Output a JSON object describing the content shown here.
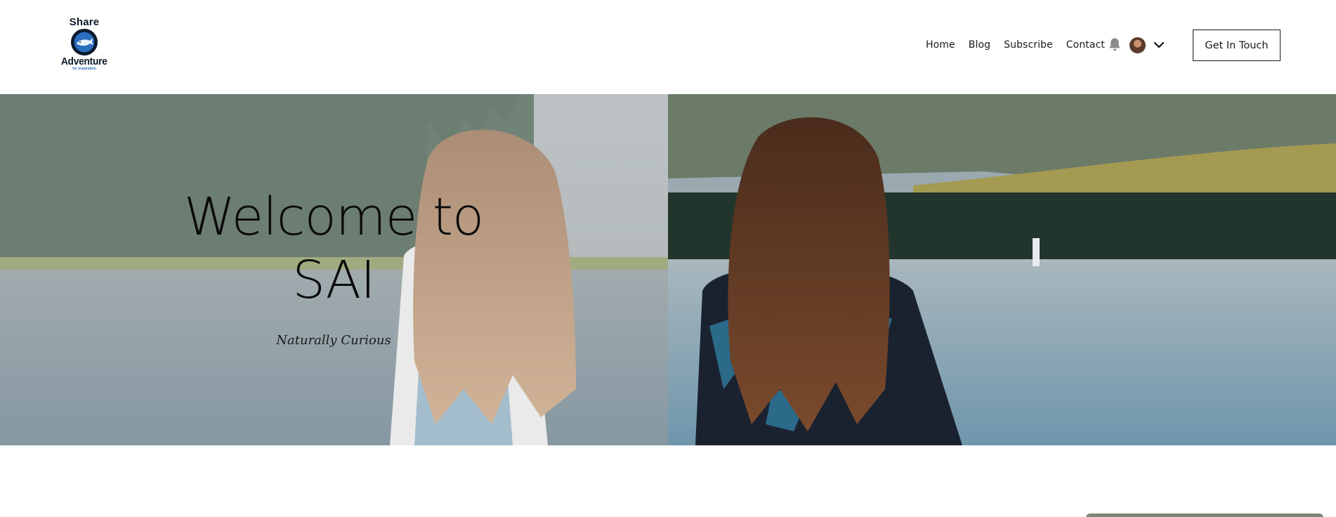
{
  "logo": {
    "top_text": "Share",
    "main_text": "Adventure",
    "sub_text": "for inspiration",
    "icon": "whale-icon"
  },
  "nav": {
    "items": [
      {
        "label": "Home"
      },
      {
        "label": "Blog"
      },
      {
        "label": "Subscribe"
      },
      {
        "label": "Contact"
      }
    ],
    "bell_icon": "bell-icon",
    "avatar_icon": "avatar",
    "chevron_icon": "chevron-down-icon",
    "cta_label": "Get In Touch"
  },
  "hero": {
    "title_line1": "Welcome to",
    "title_line2": "SAI",
    "subtitle": "Naturally Curious",
    "image": "two women with long hair sitting by a lake facing away"
  },
  "colors": {
    "text": "#1a1a1a",
    "logo_navy": "#0b1a2e",
    "logo_blue": "#2a6ebf",
    "bar": "#7a8778"
  }
}
